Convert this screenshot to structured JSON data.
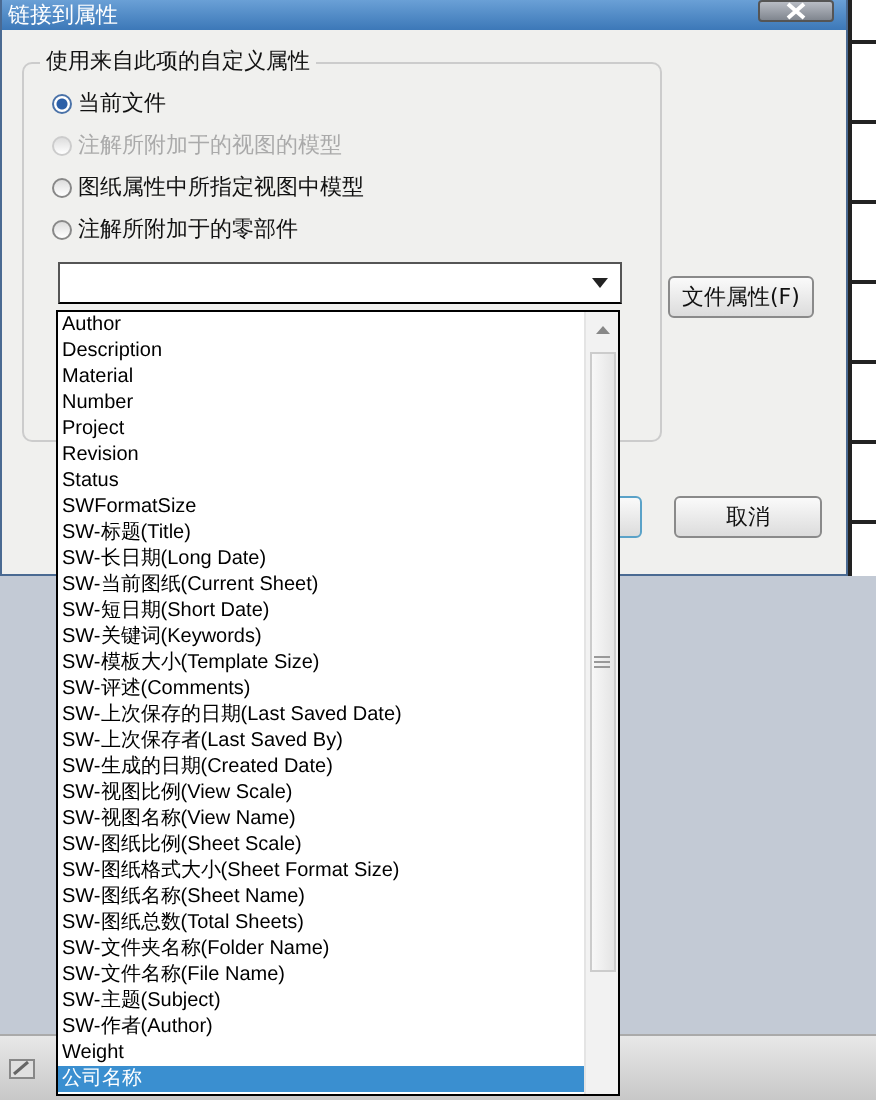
{
  "window": {
    "title": "链接到属性"
  },
  "group": {
    "title": "使用来自此项的自定义属性",
    "options": [
      {
        "label": "当前文件",
        "selected": true,
        "disabled": false
      },
      {
        "label": "注解所附加于的视图的模型",
        "selected": false,
        "disabled": true
      },
      {
        "label": "图纸属性中所指定视图中模型",
        "selected": false,
        "disabled": false
      },
      {
        "label": "注解所附加于的零部件",
        "selected": false,
        "disabled": false
      }
    ]
  },
  "property_combo": {
    "expanded": true
  },
  "file_properties_button": "文件属性(F)",
  "cancel_button": "取消",
  "dropdown": {
    "items": [
      {
        "label": "Author",
        "selected": false
      },
      {
        "label": "Description",
        "selected": false
      },
      {
        "label": "Material",
        "selected": false
      },
      {
        "label": "Number",
        "selected": false
      },
      {
        "label": "Project",
        "selected": false
      },
      {
        "label": "Revision",
        "selected": false
      },
      {
        "label": "Status",
        "selected": false
      },
      {
        "label": "SWFormatSize",
        "selected": false
      },
      {
        "label": "SW-标题(Title)",
        "selected": false
      },
      {
        "label": "SW-长日期(Long Date)",
        "selected": false
      },
      {
        "label": "SW-当前图纸(Current Sheet)",
        "selected": false
      },
      {
        "label": "SW-短日期(Short Date)",
        "selected": false
      },
      {
        "label": "SW-关键词(Keywords)",
        "selected": false
      },
      {
        "label": "SW-模板大小(Template Size)",
        "selected": false
      },
      {
        "label": "SW-评述(Comments)",
        "selected": false
      },
      {
        "label": "SW-上次保存的日期(Last Saved Date)",
        "selected": false
      },
      {
        "label": "SW-上次保存者(Last Saved By)",
        "selected": false
      },
      {
        "label": "SW-生成的日期(Created Date)",
        "selected": false
      },
      {
        "label": "SW-视图比例(View Scale)",
        "selected": false
      },
      {
        "label": "SW-视图名称(View Name)",
        "selected": false
      },
      {
        "label": "SW-图纸比例(Sheet Scale)",
        "selected": false
      },
      {
        "label": "SW-图纸格式大小(Sheet Format Size)",
        "selected": false
      },
      {
        "label": "SW-图纸名称(Sheet Name)",
        "selected": false
      },
      {
        "label": "SW-图纸总数(Total Sheets)",
        "selected": false
      },
      {
        "label": "SW-文件夹名称(Folder Name)",
        "selected": false
      },
      {
        "label": "SW-文件名称(File Name)",
        "selected": false
      },
      {
        "label": "SW-主题(Subject)",
        "selected": false
      },
      {
        "label": "SW-作者(Author)",
        "selected": false
      },
      {
        "label": "Weight",
        "selected": false
      },
      {
        "label": "公司名称",
        "selected": true
      }
    ]
  }
}
